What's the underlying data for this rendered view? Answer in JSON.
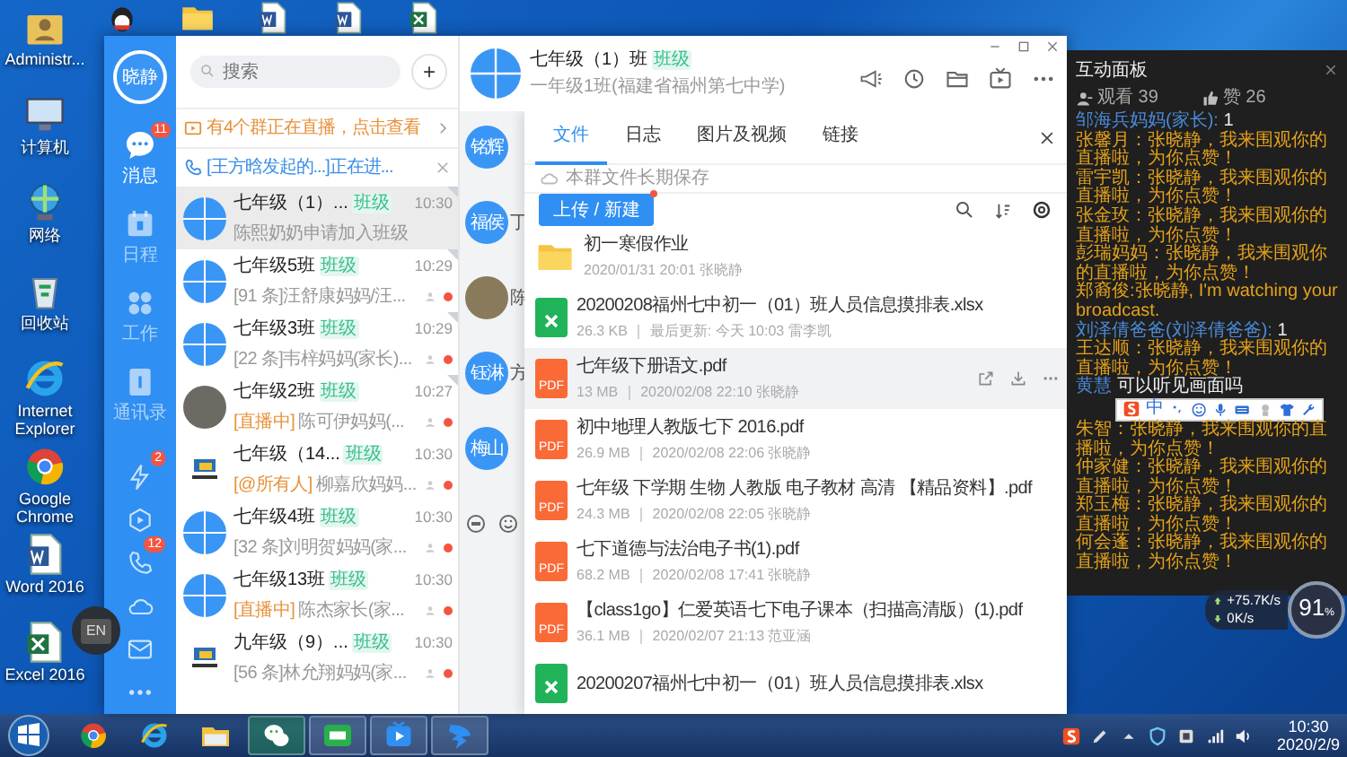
{
  "desktop_icons": [
    {
      "label": "Administr...",
      "kind": "user"
    },
    {
      "label": "计算机",
      "kind": "computer"
    },
    {
      "label": "网络",
      "kind": "network"
    },
    {
      "label": "回收站",
      "kind": "recycle"
    },
    {
      "label": "Internet Explorer",
      "kind": "ie"
    },
    {
      "label": "Google Chrome",
      "kind": "chrome"
    },
    {
      "label": "Word 2016",
      "kind": "word"
    },
    {
      "label": "Excel 2016",
      "kind": "excel"
    }
  ],
  "top_icons": [
    {
      "kind": "qq"
    },
    {
      "kind": "folder"
    },
    {
      "kind": "word"
    },
    {
      "kind": "word"
    },
    {
      "kind": "excel"
    }
  ],
  "app": {
    "user_avatar": "晓静",
    "nav": [
      {
        "label": "消息",
        "kind": "chat",
        "badge": "11",
        "selected": true
      },
      {
        "label": "日程",
        "kind": "calendar",
        "selected": false
      },
      {
        "label": "工作",
        "kind": "apps",
        "selected": false
      },
      {
        "label": "通讯录",
        "kind": "contacts",
        "selected": false
      }
    ],
    "tools": [
      {
        "kind": "bolt",
        "badge": "2"
      },
      {
        "kind": "play"
      },
      {
        "kind": "phone",
        "badge": "12"
      },
      {
        "kind": "cloud"
      },
      {
        "kind": "mail"
      },
      {
        "kind": "more"
      }
    ],
    "search": {
      "placeholder": "搜索"
    },
    "add_button": "+",
    "live_banner": "有4个群正在直播，点击查看",
    "call_banner": "[王方晗发起的...]正在进...",
    "chats": [
      {
        "title": "七年级（1）...",
        "tag": "班级",
        "time": "10:30",
        "preview": "陈熙奶奶申请加入班级",
        "kind": "grid",
        "pinned": true,
        "unread": false,
        "selected": true
      },
      {
        "title": "七年级5班",
        "tag": "班级",
        "time": "10:29",
        "preview": "[91 条]汪舒康妈妈/汪...",
        "kind": "grid",
        "pinned": true,
        "unread": true,
        "selected": false
      },
      {
        "title": "七年级3班",
        "tag": "班级",
        "time": "10:29",
        "preview": "[22 条]韦梓妈妈(家长)...",
        "kind": "grid",
        "pinned": true,
        "unread": true,
        "selected": false
      },
      {
        "title": "七年级2班",
        "tag": "班级",
        "time": "10:27",
        "alert": "[直播中]",
        "preview": "陈可伊妈妈(...",
        "kind": "photo",
        "pinned": true,
        "unread": true,
        "selected": false
      },
      {
        "title": "七年级（14...",
        "tag": "班级",
        "time": "10:30",
        "alert": "[@所有人]",
        "preview": "柳嘉欣妈妈...",
        "kind": "logo",
        "pinned": false,
        "unread": true,
        "selected": false
      },
      {
        "title": "七年级4班",
        "tag": "班级",
        "time": "10:30",
        "preview": "[32 条]刘明贺妈妈(家...",
        "kind": "grid",
        "pinned": false,
        "unread": true,
        "selected": false
      },
      {
        "title": "七年级13班",
        "tag": "班级",
        "time": "10:30",
        "alert": "[直播中]",
        "preview": "陈杰家长(家...",
        "kind": "grid",
        "pinned": false,
        "unread": true,
        "selected": false
      },
      {
        "title": "九年级（9）...",
        "tag": "班级",
        "time": "10:30",
        "preview": "[56 条]林允翔妈妈(家...",
        "kind": "logo",
        "pinned": false,
        "unread": true,
        "selected": false
      }
    ],
    "chat": {
      "title": "七年级（1）班",
      "tag": "班级",
      "subtitle": "一年级1班(福建省福州第七中学)",
      "members": [
        {
          "name": "铭辉",
          "kind": "initials"
        },
        {
          "name": "福侯",
          "kind": "initials",
          "snippet": "丁"
        },
        {
          "kind": "photo",
          "snippet": "陈"
        },
        {
          "name": "钰淋",
          "kind": "initials",
          "snippet": "方"
        },
        {
          "name": "梅山",
          "kind": "initials"
        }
      ]
    },
    "files": {
      "tabs": [
        {
          "label": "文件",
          "selected": true
        },
        {
          "label": "日志",
          "selected": false
        },
        {
          "label": "图片及视频",
          "selected": false
        },
        {
          "label": "链接",
          "selected": false
        }
      ],
      "notice": "本群文件长期保存",
      "upload_button": "上传 / 新建",
      "items": [
        {
          "kind": "folder",
          "name": "初一寒假作业",
          "meta": "2020/01/31 20:01 张晓静",
          "hovered": false
        },
        {
          "kind": "xlsx",
          "name": "20200208福州七中初一（01）班人员信息摸排表.xlsx",
          "meta": "26.3 KB ｜ 最后更新: 今天 10:03 雷李凯",
          "hovered": false
        },
        {
          "kind": "pdf",
          "icon_label": "PDF",
          "name": "七年级下册语文.pdf",
          "meta": "13 MB ｜ 2020/02/08 22:10 张晓静",
          "hovered": true
        },
        {
          "kind": "pdf",
          "icon_label": "PDF",
          "name": "初中地理人教版七下 2016.pdf",
          "meta": "26.9 MB ｜ 2020/02/08 22:06 张晓静",
          "hovered": false
        },
        {
          "kind": "pdf",
          "icon_label": "PDF",
          "name": "七年级 下学期 生物 人教版 电子教材 高清 【精品资料】.pdf",
          "meta": "24.3 MB ｜ 2020/02/08 22:05 张晓静",
          "hovered": false
        },
        {
          "kind": "pdf",
          "icon_label": "PDF",
          "name": "七下道德与法治电子书(1).pdf",
          "meta": "68.2 MB ｜ 2020/02/08 17:41 张晓静",
          "hovered": false
        },
        {
          "kind": "pdf",
          "icon_label": "PDF",
          "name": "【class1go】仁爱英语七下电子课本（扫描高清版）(1).pdf",
          "meta": "36.1 MB ｜ 2020/02/07 21:13 范亚涵",
          "hovered": false
        },
        {
          "kind": "xlsx",
          "name": "20200207福州七中初一（01）班人员信息摸排表.xlsx",
          "hovered": false
        }
      ]
    }
  },
  "live_panel": {
    "title": "互动面板",
    "viewers_label": "观看 39",
    "likes_label": "赞 26",
    "comments": [
      {
        "kind": "reply",
        "name": "邹海兵妈妈(家长):",
        "text": " 1"
      },
      {
        "kind": "cheer",
        "text": "张馨月：张晓静，我来围观你的直播啦，为你点赞！"
      },
      {
        "kind": "cheer",
        "text": "雷宇凯：张晓静，我来围观你的直播啦，为你点赞！"
      },
      {
        "kind": "cheer",
        "text": "张金玫：张晓静，我来围观你的直播啦，为你点赞！"
      },
      {
        "kind": "cheer",
        "text": "彭瑞妈妈：张晓静，我来围观你的直播啦，为你点赞！"
      },
      {
        "kind": "cheer",
        "text": "郑裔俊:张晓静, I'm watching your broadcast."
      },
      {
        "kind": "reply",
        "name": "刘泽倩爸爸(刘泽倩爸爸):",
        "text": " 1"
      },
      {
        "kind": "cheer",
        "text": "王达顺：张晓静，我来围观你的直播啦，为你点赞！"
      },
      {
        "kind": "reply",
        "name": "黄慧",
        "text": " 可以听见画面吗"
      },
      {
        "kind": "cheer",
        "text": "朱智：张晓静，我来围观你的直播啦，为你点赞！"
      },
      {
        "kind": "cheer",
        "text": "仲家健：张晓静，我来围观你的直播啦，为你点赞！"
      },
      {
        "kind": "cheer",
        "text": "郑玉梅：张晓静，我来围观你的直播啦，为你点赞！"
      },
      {
        "kind": "cheer",
        "text": "何会蓬：张晓静，我来围观你的直播啦，为你点赞！"
      }
    ]
  },
  "ime_toolbar": {
    "mode": "中"
  },
  "net_meter": {
    "usage": "91",
    "unit": "%",
    "up": "+75.7K/s",
    "down": "0K/s"
  },
  "floating_ime": "EN",
  "taskbar": {
    "apps": [
      {
        "kind": "chrome",
        "active": false
      },
      {
        "kind": "ie",
        "active": false
      },
      {
        "kind": "explorer",
        "active": false
      },
      {
        "kind": "wechat",
        "active": true
      },
      {
        "kind": "en",
        "active": true
      },
      {
        "kind": "video",
        "active": true
      },
      {
        "kind": "ding",
        "active": true
      }
    ],
    "time": "10:30",
    "date": "2020/2/9"
  }
}
